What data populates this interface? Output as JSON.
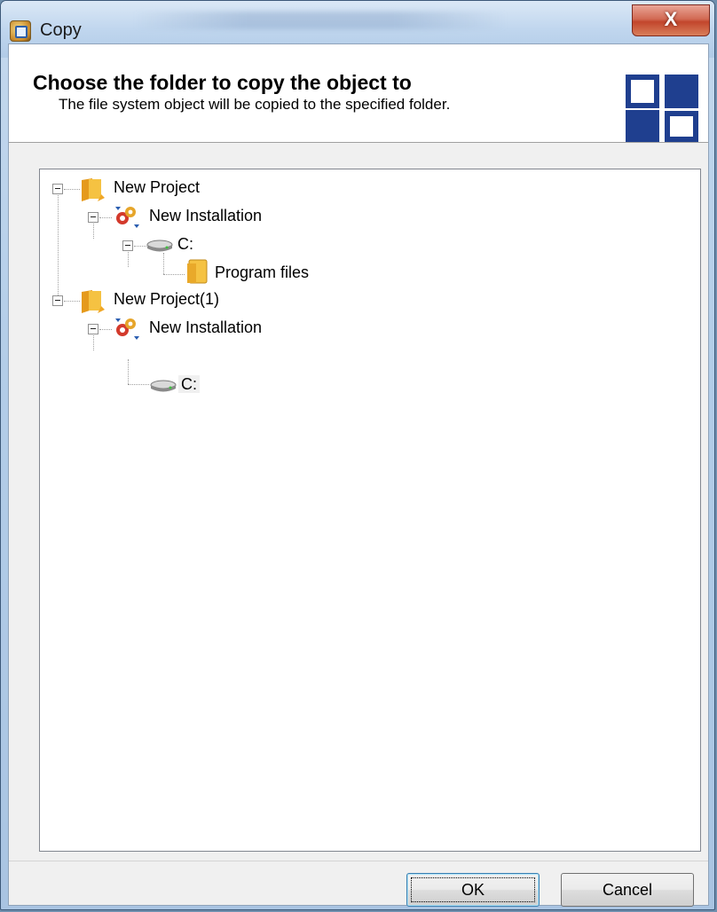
{
  "window": {
    "title": "Copy",
    "close_label": "X"
  },
  "header": {
    "title": "Choose the folder to copy the object to",
    "subtitle": "The file system object will be copied to the specified folder."
  },
  "tree": {
    "nodes": [
      {
        "label": "New Project",
        "icon": "project-folder-icon",
        "expanded": true
      },
      {
        "label": "New Installation",
        "icon": "installation-gears-icon",
        "expanded": true
      },
      {
        "label": "C:",
        "icon": "drive-icon",
        "expanded": true
      },
      {
        "label": "Program files",
        "icon": "folder-icon"
      },
      {
        "label": "New Project(1)",
        "icon": "project-folder-icon",
        "expanded": true
      },
      {
        "label": "New Installation",
        "icon": "installation-gears-icon",
        "expanded": true
      },
      {
        "label": "C:",
        "icon": "drive-icon",
        "selected": true
      }
    ]
  },
  "buttons": {
    "ok": "OK",
    "cancel": "Cancel"
  },
  "colors": {
    "logo_blue": "#1f3f8f",
    "folder_yellow": "#f5c242",
    "close_red": "#c2462c"
  }
}
